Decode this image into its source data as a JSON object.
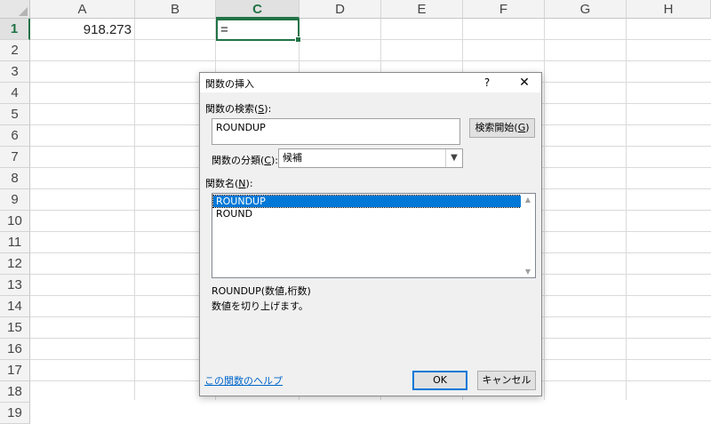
{
  "sheet": {
    "columns": [
      "A",
      "B",
      "C",
      "D",
      "E",
      "F",
      "G",
      "H"
    ],
    "active_column": "C",
    "rows": [
      "1",
      "2",
      "3",
      "4",
      "5",
      "6",
      "7",
      "8",
      "9",
      "10",
      "11",
      "12",
      "13",
      "14",
      "15",
      "16",
      "17",
      "18",
      "19"
    ],
    "active_row": "1",
    "cells": {
      "A1": "918.273",
      "C1": "="
    },
    "accent_color": "#217346"
  },
  "dialog": {
    "title": "関数の挿入",
    "help_button": "?",
    "close_button": "✕",
    "search_label_pre": "関数の検索(",
    "search_label_key": "S",
    "search_label_post": "):",
    "search_value": "ROUNDUP",
    "search_button_pre": "検索開始(",
    "search_button_key": "G",
    "search_button_post": ")",
    "category_label_pre": "関数の分類(",
    "category_label_key": "C",
    "category_label_post": "):",
    "category_value": "候補",
    "func_list_label_pre": "関数名(",
    "func_list_label_key": "N",
    "func_list_label_post": "):",
    "functions": [
      "ROUNDUP",
      "ROUND"
    ],
    "selected_function": "ROUNDUP",
    "signature": "ROUNDUP(数値,桁数)",
    "description": "数値を切り上げます。",
    "help_link": "この関数のヘルプ",
    "ok_button": "OK",
    "cancel_button": "キャンセル",
    "selection_color": "#0078d7",
    "link_color": "#0066cc"
  }
}
